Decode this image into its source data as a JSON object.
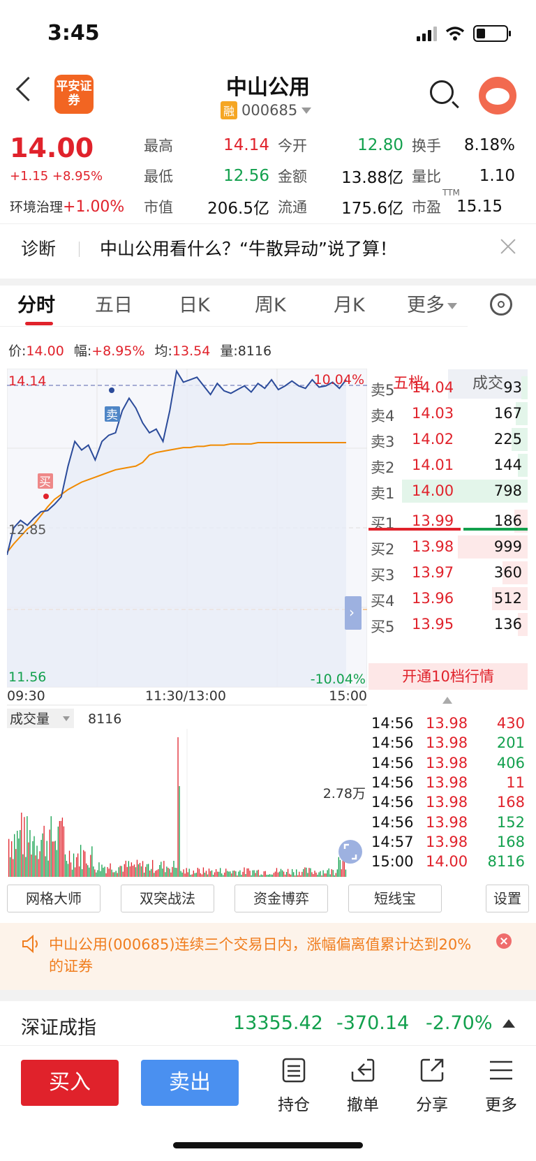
{
  "status_bar": {
    "time": "3:45"
  },
  "header": {
    "logo_text": "平安证券",
    "title": "中山公用",
    "badge": "融",
    "code": "000685"
  },
  "quote": {
    "price": "14.00",
    "change": "+1.15 +8.95%",
    "sector": "环境治理",
    "sector_change": "+1.00%",
    "rows": [
      [
        {
          "label": "最高",
          "value": "14.14",
          "color": "red"
        },
        {
          "label": "今开",
          "value": "12.80",
          "color": "green"
        },
        {
          "label": "换手",
          "value": "8.18%",
          "color": "black"
        }
      ],
      [
        {
          "label": "最低",
          "value": "12.56",
          "color": "green"
        },
        {
          "label": "金额",
          "value": "13.88亿",
          "color": "black"
        },
        {
          "label": "量比",
          "value": "1.10",
          "color": "black"
        }
      ],
      [
        {
          "label": "市值",
          "value": "206.5亿",
          "color": "black"
        },
        {
          "label": "流通",
          "value": "175.6亿",
          "color": "black"
        },
        {
          "label": "市盈",
          "value": "15.15",
          "color": "black",
          "sup": "TTM"
        }
      ]
    ]
  },
  "diagnose": {
    "label": "诊断",
    "text": "中山公用看什么？“牛散异动”说了算！"
  },
  "tabs": [
    "分时",
    "五日",
    "日K",
    "周K",
    "月K",
    "更多"
  ],
  "info_line": {
    "price_label": "价:",
    "price": "14.00",
    "amp_label": "幅:",
    "amp": "+8.95%",
    "avg_label": "均:",
    "avg": "13.54",
    "vol_label": "量:",
    "vol": "8116"
  },
  "chart_data": {
    "type": "line",
    "price_axis": {
      "high": "14.14",
      "mid": "12.85",
      "low": "11.56",
      "high_pct": "10.04%",
      "low_pct": "-10.04%",
      "range": [
        11.56,
        14.14
      ],
      "prev_close": 12.85
    },
    "time_labels": [
      "09:30",
      "11:30/13:00",
      "15:00"
    ],
    "series": [
      {
        "color": "#2b4b9a",
        "values": [
          12.63,
          12.85,
          12.91,
          12.87,
          12.93,
          12.98,
          12.99,
          13.04,
          13.1,
          13.35,
          13.55,
          13.48,
          13.52,
          13.4,
          13.55,
          13.6,
          13.62,
          13.8,
          13.9,
          13.82,
          13.7,
          13.62,
          13.65,
          13.55,
          13.8,
          14.12,
          14.03,
          14.05,
          14.07,
          14.0,
          13.93,
          14.02,
          13.96,
          13.94,
          13.97,
          14.0,
          13.95,
          14.02,
          13.98,
          14.05,
          13.97,
          14.0,
          14.04,
          14.0,
          13.98,
          14.05,
          13.99,
          14.0,
          14.03,
          13.98,
          14.05
        ]
      },
      {
        "color": "#f08a00",
        "values": [
          12.65,
          12.72,
          12.78,
          12.84,
          12.88,
          12.95,
          13.02,
          13.08,
          13.12,
          13.16,
          13.19,
          13.22,
          13.24,
          13.26,
          13.28,
          13.3,
          13.32,
          13.33,
          13.34,
          13.35,
          13.38,
          13.44,
          13.46,
          13.47,
          13.48,
          13.49,
          13.5,
          13.5,
          13.51,
          13.51,
          13.52,
          13.52,
          13.52,
          13.53,
          13.53,
          13.53,
          13.53,
          13.54,
          13.54,
          13.54,
          13.54,
          13.54,
          13.54,
          13.54,
          13.54,
          13.54,
          13.54,
          13.54,
          13.54,
          13.54,
          13.54
        ]
      }
    ],
    "markers": [
      {
        "label": "买"
      },
      {
        "label": "卖"
      }
    ],
    "volume": {
      "label": "成交量",
      "value": "8116",
      "scale_label": "2.78万"
    }
  },
  "order_book": {
    "tabs": [
      "五档",
      "成交"
    ],
    "sells": [
      {
        "label": "卖5",
        "price": "14.04",
        "vol": "93"
      },
      {
        "label": "卖4",
        "price": "14.03",
        "vol": "167"
      },
      {
        "label": "卖3",
        "price": "14.02",
        "vol": "225"
      },
      {
        "label": "卖2",
        "price": "14.01",
        "vol": "144"
      },
      {
        "label": "卖1",
        "price": "14.00",
        "vol": "798"
      }
    ],
    "buys": [
      {
        "label": "买1",
        "price": "13.99",
        "vol": "186"
      },
      {
        "label": "买2",
        "price": "13.98",
        "vol": "999"
      },
      {
        "label": "买3",
        "price": "13.97",
        "vol": "360"
      },
      {
        "label": "买4",
        "price": "13.96",
        "vol": "512"
      },
      {
        "label": "买5",
        "price": "13.95",
        "vol": "136"
      }
    ],
    "open10": "开通10档行情"
  },
  "ticks": [
    {
      "time": "14:56",
      "price": "13.98",
      "vol": "430",
      "color": "red"
    },
    {
      "time": "14:56",
      "price": "13.98",
      "vol": "201",
      "color": "green"
    },
    {
      "time": "14:56",
      "price": "13.98",
      "vol": "406",
      "color": "green"
    },
    {
      "time": "14:56",
      "price": "13.98",
      "vol": "11",
      "color": "red"
    },
    {
      "time": "14:56",
      "price": "13.98",
      "vol": "168",
      "color": "red"
    },
    {
      "time": "14:56",
      "price": "13.98",
      "vol": "152",
      "color": "green"
    },
    {
      "time": "14:57",
      "price": "13.98",
      "vol": "168",
      "color": "green"
    },
    {
      "time": "15:00",
      "price": "14.00",
      "vol": "8116",
      "color": "green"
    }
  ],
  "tools": [
    "网格大师",
    "双突战法",
    "资金博弈",
    "短线宝",
    "设置"
  ],
  "notice": {
    "text": "中山公用(000685)连续三个交易日内，涨幅偏离值累计达到20%的证券"
  },
  "index": {
    "name": "深证成指",
    "value": "13355.42",
    "change": "-370.14",
    "pct": "-2.70%"
  },
  "bottom": {
    "buy": "买入",
    "sell": "卖出",
    "items": [
      "持仓",
      "撤单",
      "分享",
      "更多"
    ]
  }
}
